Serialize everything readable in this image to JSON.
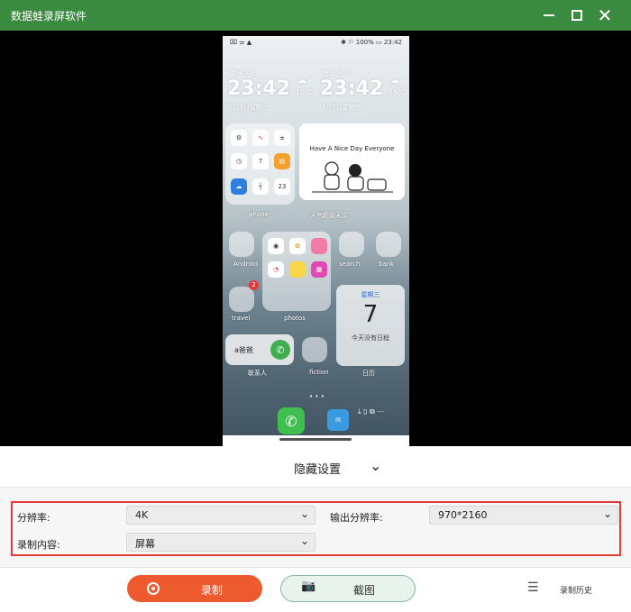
{
  "window": {
    "title": "数据蛙录屏软件"
  },
  "phone": {
    "status": {
      "left": "⌧ ⚌ ▲",
      "right": "✱ ⚐ 100% ▭ 23:42"
    },
    "clock1": {
      "location": "湖州区 ⌂",
      "time": "23:42",
      "date": "7月7日星期三",
      "temp": "19℃"
    },
    "clock2": {
      "location": "萝山区 ⚲",
      "time": "23:42",
      "date": "7月7日星期三",
      "temp": "25℃"
    },
    "widget": {
      "text": "Have A Nice Day Everyone"
    },
    "folders": {
      "phone": "phone",
      "widget_label": "天气超级天文",
      "android": "Android",
      "photos": "photos",
      "search": "search",
      "bank": "bank",
      "travel": "travel",
      "contacts": "联系人",
      "fiction": "fiction",
      "calendar": "日历"
    },
    "badge": "2",
    "calendar": {
      "weekday": "星期三",
      "day": "7",
      "events": "今天没有日程"
    },
    "contact": {
      "name": "a爸爸"
    }
  },
  "panel": {
    "hide_settings": "隐藏设置",
    "resolution_label": "分辨率:",
    "resolution_value": "4K",
    "output_label": "输出分辨率:",
    "output_value": "970*2160",
    "content_label": "录制内容:",
    "content_value": "屏幕"
  },
  "actions": {
    "record": "录制",
    "screenshot": "截图",
    "history": "录制历史"
  },
  "colors": {
    "titlebar": "#3a8a3f",
    "record": "#ec5a2e",
    "highlight": "#e03a3a"
  }
}
